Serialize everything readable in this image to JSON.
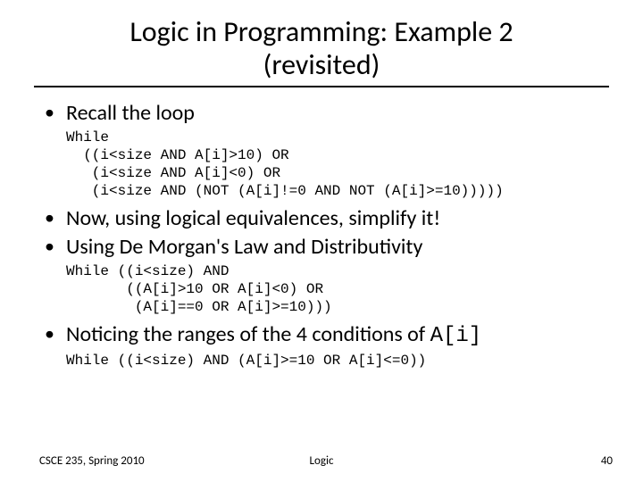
{
  "title_line1": "Logic in Programming: Example 2",
  "title_line2": "(revisited)",
  "bullets": {
    "b1": "Recall the loop",
    "b2": "Now, using logical equivalences, simplify it!",
    "b3": "Using De Morgan's Law and Distributivity",
    "b4_prefix": "Noticing the ranges of the 4 conditions of ",
    "b4_code": "A[i]"
  },
  "code1": "While\n  ((i<size AND A[i]>10) OR\n   (i<size AND A[i]<0) OR\n   (i<size AND (NOT (A[i]!=0 AND NOT (A[i]>=10)))))",
  "code2": "While ((i<size) AND\n       ((A[i]>10 OR A[i]<0) OR\n        (A[i]==0 OR A[i]>=10)))",
  "code3": "While ((i<size) AND (A[i]>=10 OR A[i]<=0))",
  "footer": {
    "left": "CSCE 235, Spring 2010",
    "center": "Logic",
    "right": "40"
  }
}
